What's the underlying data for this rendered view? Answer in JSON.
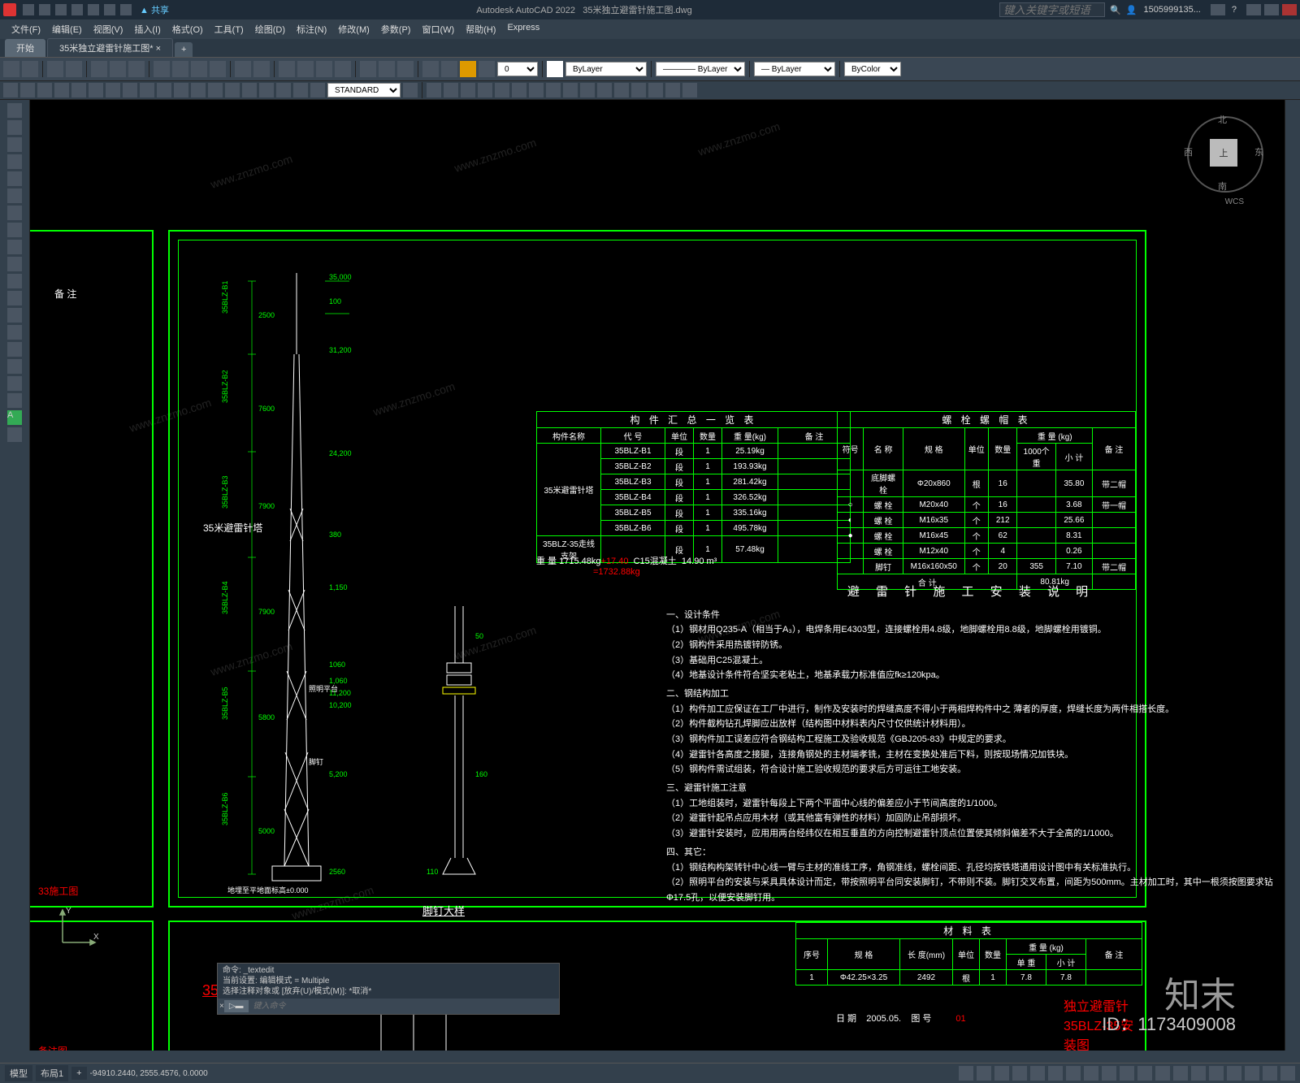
{
  "app": {
    "title_left": "Autodesk AutoCAD 2022",
    "title_right": "35米独立避雷针施工图.dwg",
    "search_placeholder": "键入关键字或短语",
    "user": "1505999135...",
    "share": "共享"
  },
  "menu": [
    "文件(F)",
    "编辑(E)",
    "视图(V)",
    "插入(I)",
    "格式(O)",
    "工具(T)",
    "绘图(D)",
    "标注(N)",
    "修改(M)",
    "参数(P)",
    "窗口(W)",
    "帮助(H)",
    "Express"
  ],
  "tabs": {
    "home": "开始",
    "doc": "35米独立避雷针施工图*",
    "plus": "+"
  },
  "ribbon": {
    "style_field": "STANDARD",
    "layer": "ByLayer",
    "linetype": "ByLayer",
    "lineweight": "ByLayer",
    "color": "ByColor"
  },
  "viewcube": {
    "top": "上",
    "n": "北",
    "s": "南",
    "e": "东",
    "w": "西",
    "wcs": "WCS"
  },
  "canvas": {
    "section_label": "35米避雷针塔",
    "install_title": "35BLZ-35安装图",
    "install_title2": "独立避雷针35BLZ-35安装图",
    "bolt_detail": "脚钉大样",
    "beizhu": "备 注",
    "red_left": "33施工图",
    "red_left2": "备注图",
    "date_label": "日 期",
    "date_val": "2005.05.",
    "fig_label": "图 号",
    "fig_val": "01",
    "ground_note": "地埋至平地面标高±0.000"
  },
  "table_parts": {
    "title": "构 件 汇 总 一 览 表",
    "headers": [
      "构件名称",
      "代 号",
      "单位",
      "数量",
      "重 量(kg)",
      "备 注"
    ],
    "name_span": "35米避雷针塔",
    "rows": [
      {
        "code": "35BLZ-B1",
        "unit": "段",
        "qty": "1",
        "wt": "25.19kg",
        "note": ""
      },
      {
        "code": "35BLZ-B2",
        "unit": "段",
        "qty": "1",
        "wt": "193.93kg",
        "note": ""
      },
      {
        "code": "35BLZ-B3",
        "unit": "段",
        "qty": "1",
        "wt": "281.42kg",
        "note": ""
      },
      {
        "code": "35BLZ-B4",
        "unit": "段",
        "qty": "1",
        "wt": "326.52kg",
        "note": ""
      },
      {
        "code": "35BLZ-B5",
        "unit": "段",
        "qty": "1",
        "wt": "335.16kg",
        "note": ""
      },
      {
        "code": "35BLZ-B6",
        "unit": "段",
        "qty": "1",
        "wt": "495.78kg",
        "note": ""
      },
      {
        "code": "35BLZ-35走线支架",
        "unit": "段",
        "qty": "1",
        "wt": "57.48kg",
        "note": ""
      }
    ],
    "sum_label": "重 量",
    "sum_val": "1715.48kg",
    "sum_add": "+17.40",
    "c15": "C15混凝土",
    "c15v": "14.90 m³",
    "sum_total": "=1732.88kg"
  },
  "table_bolts": {
    "title": "螺 栓 螺 帽 表",
    "headers": [
      "符号",
      "名 称",
      "规 格",
      "单位",
      "数量",
      "重 量 (kg)",
      "备 注"
    ],
    "sub": [
      "1000个重",
      "小 计"
    ],
    "rows": [
      {
        "sym": "",
        "name": "底脚螺栓",
        "spec": "Φ20x860",
        "unit": "根",
        "qty": "16",
        "w1": "",
        "w2": "35.80",
        "note": "带二帽"
      },
      {
        "sym": "○",
        "name": "螺 栓",
        "spec": "M20x40",
        "unit": "个",
        "qty": "16",
        "w1": "",
        "w2": "3.68",
        "note": "带一帽"
      },
      {
        "sym": "◐",
        "name": "螺 栓",
        "spec": "M16x35",
        "unit": "个",
        "qty": "212",
        "w1": "",
        "w2": "25.66",
        "note": ""
      },
      {
        "sym": "●",
        "name": "螺 栓",
        "spec": "M16x45",
        "unit": "个",
        "qty": "62",
        "w1": "",
        "w2": "8.31",
        "note": ""
      },
      {
        "sym": "",
        "name": "螺 栓",
        "spec": "M12x40",
        "unit": "个",
        "qty": "4",
        "w1": "",
        "w2": "0.26",
        "note": ""
      },
      {
        "sym": "",
        "name": "脚钉",
        "spec": "M16x160x50",
        "unit": "个",
        "qty": "20",
        "w1": "355",
        "w2": "7.10",
        "note": "带二帽"
      }
    ],
    "total_label": "合 计",
    "total_val": "80.81kg"
  },
  "table_material": {
    "title": "材 料 表",
    "headers": [
      "序号",
      "规 格",
      "长 度(mm)",
      "单位",
      "数量",
      "重 量 (kg)",
      "备 注"
    ],
    "sub": [
      "单 重",
      "小 计"
    ],
    "row1": [
      "1",
      "Φ42.25×3.25",
      "2492",
      "根",
      "1",
      "7.8",
      "7.8",
      ""
    ]
  },
  "notes": {
    "title": "避 雷 针 施 工 安 装 说 明",
    "s1": "一、设计条件",
    "s1_1": "（1）钢材用Q235-A（相当于A₃），电焊条用E4303型，连接螺栓用4.8级，地脚螺栓用8.8级，地脚螺栓用镀铜。",
    "s1_2": "（2）钢构件采用热镀锌防锈。",
    "s1_3": "（3）基础用C25混凝土。",
    "s1_4": "（4）地基设计条件符合坚实老粘土，地基承载力标准值应fk≥120kpa。",
    "s2": "二、钢结构加工",
    "s2_1": "（1）构件加工应保证在工厂中进行，制作及安装时的焊缝高度不得小于两相焊构件中之  薄者的厚度，焊缝长度为两件相搭长度。",
    "s2_2": "（2）构件截构钻孔焊脚应出放样（结构图中材料表内尺寸仅供统计材料用）。",
    "s2_3": "（3）钢构件加工误差应符合钢结构工程施工及验收规范《GBJ205-83》中规定的要求。",
    "s2_4": "（4）避雷针各高度之接腿，连接角钢处的主材端孝铣，主材在变换处准后下料，则按现场情况加铁块。",
    "s2_5": "（5）钢构件需试组装，符合设计施工验收规范的要求后方可运往工地安装。",
    "s3": "三、避雷针施工注意",
    "s3_1": "（1）工地组装时，避雷针每段上下两个平面中心线的偏差应小于节间高度的1/1000。",
    "s3_2": "（2）避雷针起吊点应用木材（或其他富有弹性的材料）加固防止吊部损坏。",
    "s3_3": "（3）避雷针安装时，应用用两台经纬仪在相互垂直的方向控制避雷针顶点位置使其倾斜偏差不大于全高的1/1000。",
    "s4": "四、其它：",
    "s4_1": "（1）钢结构构架转针中心线一臂与主材的准线工序，角钢准线，螺栓间距、孔径均按铁塔通用设计图中有关标准执行。",
    "s4_2": "（2）照明平台的安装与采具具体设计而定，带按照明平台同安装脚钉，不带则不装。脚钉交叉布置，间距为500mm。主材加工时，其中一根须按图要求钻Φ17.5孔，以便安装脚钉用。"
  },
  "cmd": {
    "h1": "命令: _textedit",
    "h2": "当前设置: 编辑模式 = Multiple",
    "h3": "选择注释对象或 [放弃(U)/模式(M)]: *取消*",
    "placeholder": "键入命令"
  },
  "status": {
    "model": "模型",
    "layout": "布局1",
    "coords": "-94910.2440, 2555.4576, 0.0000"
  },
  "watermark": {
    "brand": "知末",
    "id": "ID：1173409008",
    "url": "www.znzmo.com"
  }
}
